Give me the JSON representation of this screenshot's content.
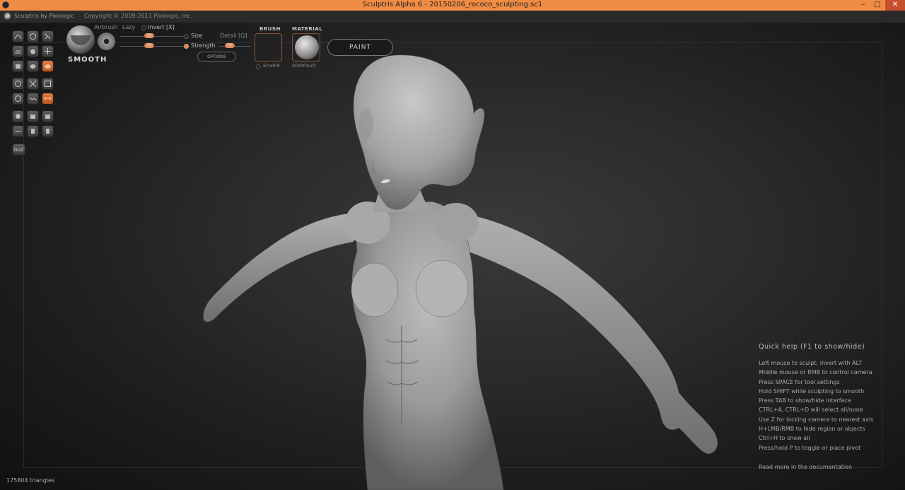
{
  "window": {
    "title": "Sculptris Alpha 6 - 20150206_rococo_sculpting.sc1",
    "min": "–",
    "max": "□",
    "close": "✕"
  },
  "appbar": {
    "brand": "Sculptris by Pixologic",
    "copyright": "Copyright © 2009-2011 Pixologic, Inc."
  },
  "brush": {
    "name": "SMOOTH",
    "airbrush": "Airbrush",
    "lazy": "Lazy",
    "invert": "Invert [X]",
    "size": "Size",
    "strength": "Strength",
    "detail": "Detail [Q]",
    "options": "OPTIONS"
  },
  "brush_slot": {
    "header": "BRUSH",
    "enable": "Enable"
  },
  "material": {
    "header": "MATERIAL",
    "name": "00default"
  },
  "paint_button": "PAINT",
  "goz": "GoZ",
  "help": {
    "title": "Quick help (F1 to show/hide)",
    "lines": [
      "Left mouse to sculpt, invert with ALT",
      "Middle mouse or RMB to control camera",
      "Press SPACE for tool settings",
      "Hold SHIFT while sculpting to smooth",
      "Press TAB to show/hide interface",
      "CTRL+A, CTRL+D will select all/none",
      "Use Z for locking camera to nearest axis",
      "H+LMB/RMB to hide region or objects",
      "Ctrl+H to show all",
      "Press/hold P to toggle or place pivot"
    ],
    "more": "Read more in the documentation"
  },
  "status": {
    "triangles": "175804 triangles"
  },
  "colors": {
    "accent": "#f08c44",
    "active_tool": "#d26a30"
  }
}
